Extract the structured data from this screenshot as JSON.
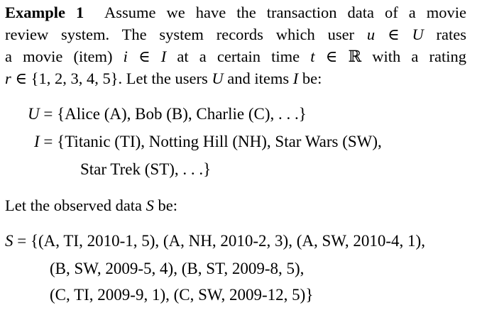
{
  "example": {
    "heading": "Example 1",
    "lines": [
      "Assume we have the transaction data of a movie",
      "review system. The system records which user u ∈ U rates",
      "a movie (item) i ∈ I at a certain time t ∈ ℝ with a rating",
      "r ∈ {1, 2, 3, 4, 5}. Let the users U and items I be:"
    ]
  },
  "equations": {
    "users_lhs": "U",
    "users_rhs": "{Alice (A), Bob (B), Charlie (C), . . .}",
    "items_lhs": "I",
    "items_rhs_1": "{Titanic (TI), Notting Hill (NH), Star Wars (SW),",
    "items_rhs_2": "Star Trek (ST), . . .}"
  },
  "observed": {
    "intro": "Let the observed data S be:",
    "lhs": "S",
    "line_1": "{(A, TI, 2010-1, 5), (A, NH, 2010-2, 3), (A, SW, 2010-4, 1),",
    "line_2": "(B, SW, 2009-5, 4), (B, ST, 2009-8, 5),",
    "line_3": "(C, TI, 2009-9, 1), (C, SW, 2009-12, 5)}"
  }
}
